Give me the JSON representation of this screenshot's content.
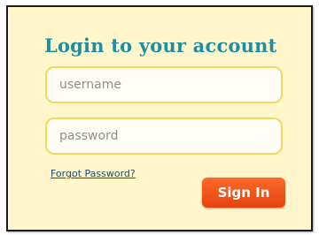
{
  "login": {
    "title": "Login to your account",
    "username_placeholder": "username",
    "password_placeholder": "password",
    "forgot_label": "Forgot Password?",
    "signin_label": "Sign In"
  },
  "colors": {
    "title": "#1f8ea0",
    "panel_background": "#fff6cc",
    "input_border": "#f2d95c",
    "button": "#f2561c",
    "link": "#18506b"
  }
}
